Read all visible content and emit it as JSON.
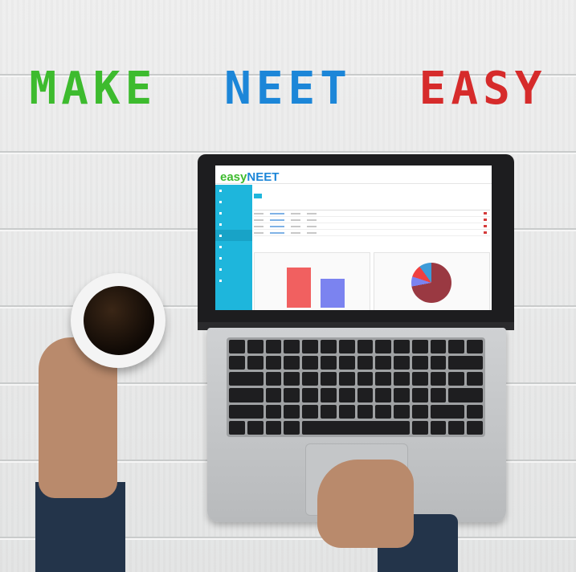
{
  "headline": {
    "word1": "MAKE",
    "word2": "NEET",
    "word3": "EASY"
  },
  "app": {
    "logo_prefix": "easy",
    "logo_suffix": "NEET",
    "brand_color": "#1eb6dc"
  },
  "colors": {
    "make": "#3dbb2e",
    "neet": "#1c86d8",
    "easy": "#d62b2b",
    "bar1": "#f16060",
    "bar2": "#7b83f0"
  },
  "icons": [
    "coffee-mug-icon",
    "laptop-icon"
  ]
}
